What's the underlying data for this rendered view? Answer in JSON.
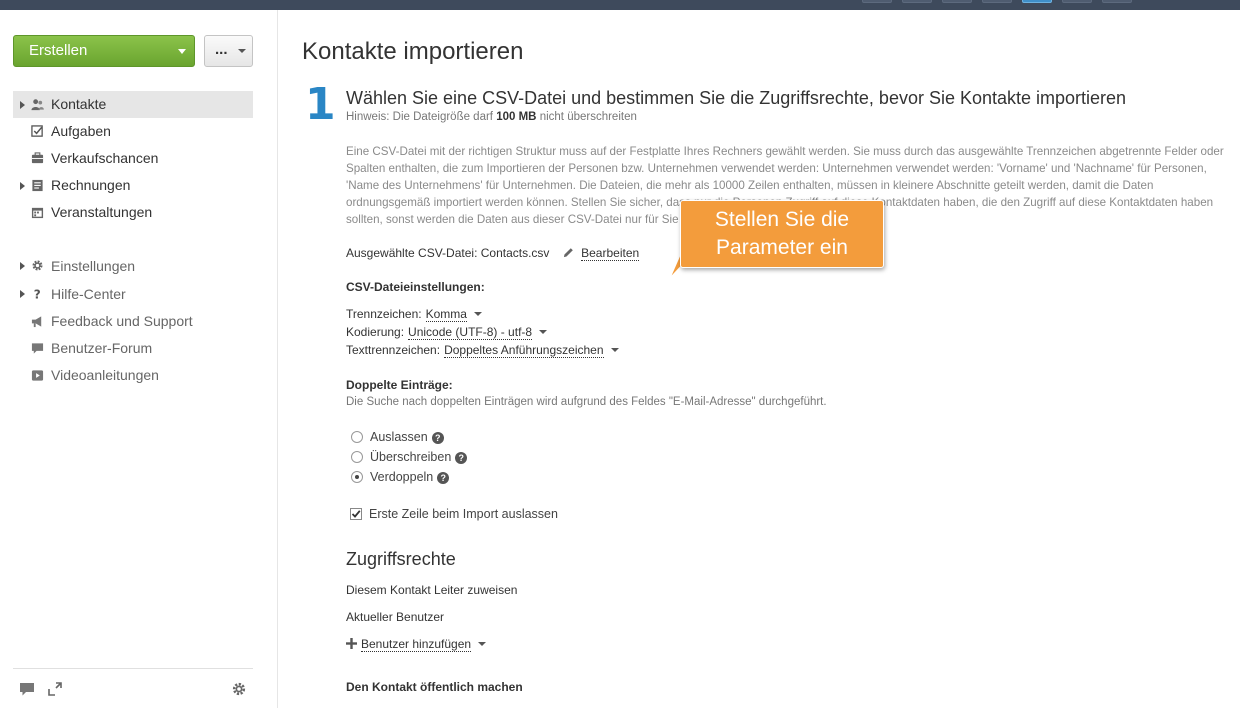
{
  "sidebar": {
    "create_label": "Erstellen",
    "more_label": "...",
    "nav_main": [
      {
        "label": "Kontakte",
        "icon": "contacts-icon",
        "active": true,
        "expandable": true
      },
      {
        "label": "Aufgaben",
        "icon": "tasks-icon",
        "active": false,
        "expandable": false
      },
      {
        "label": "Verkaufschancen",
        "icon": "opportunities-icon",
        "active": false,
        "expandable": false
      },
      {
        "label": "Rechnungen",
        "icon": "invoices-icon",
        "active": false,
        "expandable": true
      },
      {
        "label": "Veranstaltungen",
        "icon": "events-icon",
        "active": false,
        "expandable": false
      }
    ],
    "nav_secondary": [
      {
        "label": "Einstellungen",
        "icon": "gear-icon",
        "expandable": true
      },
      {
        "label": "Hilfe-Center",
        "icon": "help-icon",
        "expandable": true
      },
      {
        "label": "Feedback und Support",
        "icon": "megaphone-icon",
        "expandable": false
      },
      {
        "label": "Benutzer-Forum",
        "icon": "chat-bubble-icon",
        "expandable": false
      },
      {
        "label": "Videoanleitungen",
        "icon": "video-icon",
        "expandable": false
      }
    ]
  },
  "main": {
    "title": "Kontakte importieren",
    "step_number": "1",
    "step_title": "Wählen Sie eine CSV-Datei und bestimmen Sie die Zugriffsrechte, bevor Sie Kontakte importieren",
    "hint_prefix": "Hinweis: Die Dateigröße darf",
    "hint_size": "100 MB",
    "hint_suffix": "nicht überschreiten",
    "description": "Eine CSV-Datei mit der richtigen Struktur muss auf der Festplatte Ihres Rechners gewählt werden. Sie muss durch das ausgewählte Trennzeichen abgetrennte Felder oder Spalten enthalten, die zum Importieren der Personen bzw. Unternehmen verwendet werden: Unternehmen verwendet werden: 'Vorname' und 'Nachname' für Personen, 'Name des Unternehmens' für Unternehmen. Die Dateien, die mehr als 10000 Zeilen enthalten, müssen in kleinere Abschnitte geteilt werden, damit die Daten ordnungsgemäß importiert werden können. Stellen Sie sicher, dass nur die Personen Zugriff auf diese Kontaktdaten haben, die den Zugriff auf diese Kontaktdaten haben sollten, sonst werden die Daten aus dieser CSV-Datei nur für Sie sichtbar sein.",
    "selected_file_label": "Ausgewählte CSV-Datei: Contacts.csv",
    "edit_label": "Bearbeiten",
    "csv_settings_title": "CSV-Dateieinstellungen:",
    "delimiter_label": "Trennzeichen:",
    "delimiter_value": "Komma",
    "encoding_label": "Kodierung:",
    "encoding_value": "Unicode (UTF-8) - utf-8",
    "text_qualifier_label": "Texttrennzeichen:",
    "text_qualifier_value": "Doppeltes Anführungszeichen",
    "duplicates_title": "Doppelte Einträge:",
    "duplicates_note": "Die Suche nach doppelten Einträgen wird aufgrund des Feldes \"E-Mail-Adresse\" durchgeführt.",
    "duplicate_options": [
      {
        "label": "Auslassen",
        "checked": false
      },
      {
        "label": "Überschreiben",
        "checked": false
      },
      {
        "label": "Verdoppeln",
        "checked": true
      }
    ],
    "skip_first_row_label": "Erste Zeile beim Import auslassen",
    "skip_first_row_checked": true,
    "access_title": "Zugriffsrechte",
    "assign_manager_label": "Diesem Kontakt Leiter zuweisen",
    "current_user_label": "Aktueller Benutzer",
    "add_user_label": "Benutzer hinzufügen",
    "make_public_label": "Den Kontakt öffentlich machen"
  },
  "callout": {
    "line1": "Stellen Sie die",
    "line2": "Parameter ein",
    "color": "#f39c3c"
  },
  "colors": {
    "accent_blue": "#2a86c5",
    "create_green": "#7cb53d",
    "topbar": "#3e4a5c"
  }
}
